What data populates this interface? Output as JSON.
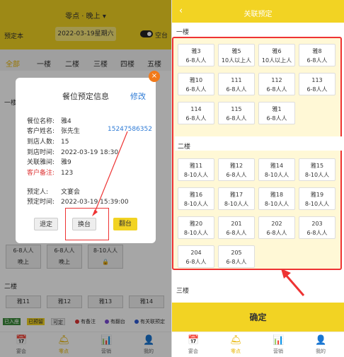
{
  "left": {
    "title": "零点 · 晚上 ▾",
    "reserve_label": "预定本",
    "date": "2022-03-19星期六",
    "empty_label": "空台",
    "tabs": [
      "全部",
      "一楼",
      "二楼",
      "三楼",
      "四楼",
      "五楼"
    ],
    "floor1": "一楼",
    "floor2": "二楼",
    "bg_cards": [
      {
        "line1": "6-8人人",
        "line2": "晚上"
      },
      {
        "line1": "6-8人人",
        "line2": "晚上"
      },
      {
        "line1": "8-10人人",
        "line2": ""
      }
    ],
    "bg_row2": [
      "雅11",
      "雅12",
      "雅13",
      "雅14"
    ],
    "legend": [
      "已入座",
      "已预留",
      "可定",
      "有备注",
      "有翻台",
      "有关联预定"
    ],
    "modal": {
      "title": "餐位预定信息",
      "edit": "修改",
      "close": "×",
      "rows": [
        {
          "k": "餐位名称:",
          "v": "雅4"
        },
        {
          "k": "客户姓名:",
          "v": "张先生"
        },
        {
          "k": "到店人数:",
          "v": "15"
        },
        {
          "k": "到店时间:",
          "v": "2022-03-19 18:30"
        },
        {
          "k": "关联雅间:",
          "v": "雅9"
        },
        {
          "k": "客户备注:",
          "v": "123"
        }
      ],
      "phone": "15247586352",
      "booker": {
        "k": "预定人:",
        "v": "文宴会"
      },
      "book_time": {
        "k": "预定时间:",
        "v": "2022-03-19 15:39:00"
      },
      "btn_cancel": "退定",
      "btn_switch": "换台",
      "btn_turn": "翻台"
    }
  },
  "tabbar": {
    "left": [
      {
        "label": "宴会",
        "icon": "calendar-icon"
      },
      {
        "label": "零点",
        "icon": "bell-icon"
      },
      {
        "label": "营销",
        "icon": "chart-icon"
      },
      {
        "label": "我的",
        "icon": "user-icon"
      }
    ],
    "right": [
      {
        "label": "宴会",
        "icon": "calendar-icon"
      },
      {
        "label": "零点",
        "icon": "bell-icon"
      },
      {
        "label": "营销",
        "icon": "chart-icon"
      },
      {
        "label": "我的",
        "icon": "user-icon"
      }
    ]
  },
  "right": {
    "back": "‹",
    "title": "关联预定",
    "floor1": "一楼",
    "floor2": "二楼",
    "floor3": "三楼",
    "floor1_tiles": [
      {
        "name": "雅3",
        "cap": "6-8人人"
      },
      {
        "name": "雅5",
        "cap": "10人以上人"
      },
      {
        "name": "雅6",
        "cap": "10人以上人"
      },
      {
        "name": "雅8",
        "cap": "6-8人人"
      },
      {
        "name": "雅10",
        "cap": "6-8人人"
      },
      {
        "name": "111",
        "cap": "6-8人人"
      },
      {
        "name": "112",
        "cap": "6-8人人"
      },
      {
        "name": "113",
        "cap": "6-8人人"
      },
      {
        "name": "114",
        "cap": "6-8人人"
      },
      {
        "name": "115",
        "cap": "6-8人人"
      },
      {
        "name": "雅1",
        "cap": "6-8人人"
      }
    ],
    "floor2_tiles": [
      {
        "name": "雅11",
        "cap": "8-10人人"
      },
      {
        "name": "雅12",
        "cap": "6-8人人"
      },
      {
        "name": "雅14",
        "cap": "8-10人人"
      },
      {
        "name": "雅15",
        "cap": "8-10人人"
      },
      {
        "name": "雅16",
        "cap": "8-10人人"
      },
      {
        "name": "雅17",
        "cap": "8-10人人"
      },
      {
        "name": "雅18",
        "cap": "8-10人人"
      },
      {
        "name": "雅19",
        "cap": "8-10人人"
      },
      {
        "name": "雅20",
        "cap": "8-10人人"
      },
      {
        "name": "201",
        "cap": "6-8人人"
      },
      {
        "name": "202",
        "cap": "6-8人人"
      },
      {
        "name": "203",
        "cap": "6-8人人"
      },
      {
        "name": "204",
        "cap": "6-8人人"
      },
      {
        "name": "205",
        "cap": "6-8人人"
      }
    ],
    "confirm": "确定"
  },
  "colors": {
    "brand": "#f2d323",
    "link": "#2e7bd6",
    "highlight": "#e33333"
  }
}
